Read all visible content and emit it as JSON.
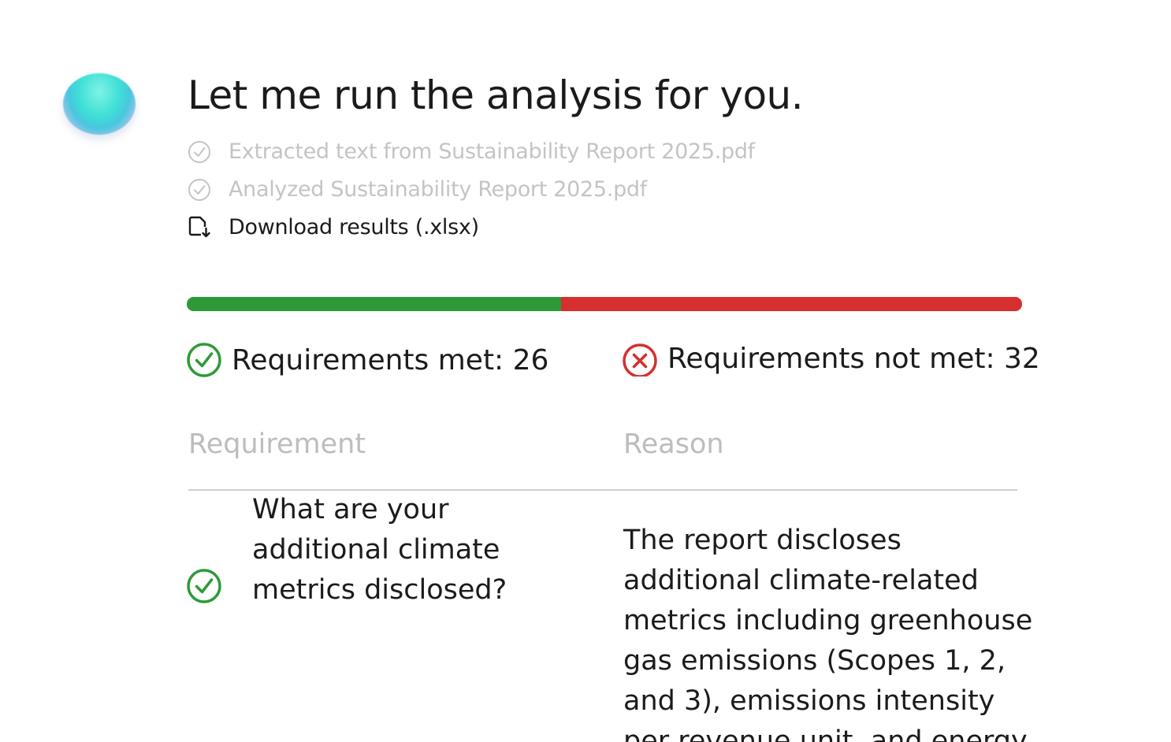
{
  "message": {
    "title": "Let me run the analysis for you."
  },
  "steps": [
    {
      "label": "Extracted text from Sustainability Report 2025.pdf",
      "icon": "check-circle-icon",
      "status": "done"
    },
    {
      "label": "Analyzed Sustainability Report 2025.pdf",
      "icon": "check-circle-icon",
      "status": "done"
    },
    {
      "label": "Download results (.xlsx)",
      "icon": "file-download-icon",
      "status": "link"
    }
  ],
  "summary": {
    "met_label": "Requirements met: 26",
    "not_met_label": "Requirements not met: 32",
    "met_count": 26,
    "not_met_count": 32,
    "met_color": "#2e9a37",
    "not_met_color": "#d62f2f"
  },
  "table": {
    "headers": {
      "requirement": "Requirement",
      "reason": "Reason"
    },
    "rows": [
      {
        "status": "met",
        "requirement": "What are your additional climate metrics disclosed?",
        "reason": "The report discloses additional climate-related metrics including greenhouse gas emissions (Scopes 1, 2, and 3), emissions intensity per revenue unit, and energy"
      }
    ]
  }
}
